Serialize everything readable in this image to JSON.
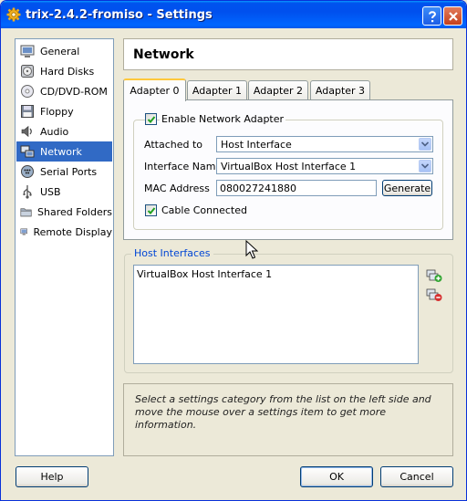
{
  "window": {
    "title": "trix-2.4.2-fromiso - Settings"
  },
  "sidebar": {
    "items": [
      {
        "label": "General",
        "icon": "general-icon",
        "selected": false
      },
      {
        "label": "Hard Disks",
        "icon": "hard-disk-icon",
        "selected": false
      },
      {
        "label": "CD/DVD-ROM",
        "icon": "cd-dvd-icon",
        "selected": false
      },
      {
        "label": "Floppy",
        "icon": "floppy-icon",
        "selected": false
      },
      {
        "label": "Audio",
        "icon": "audio-icon",
        "selected": false
      },
      {
        "label": "Network",
        "icon": "network-icon",
        "selected": true
      },
      {
        "label": "Serial Ports",
        "icon": "serial-port-icon",
        "selected": false
      },
      {
        "label": "USB",
        "icon": "usb-icon",
        "selected": false
      },
      {
        "label": "Shared Folders",
        "icon": "shared-folders-icon",
        "selected": false
      },
      {
        "label": "Remote Display",
        "icon": "remote-display-icon",
        "selected": false
      }
    ]
  },
  "header": {
    "title": "Network"
  },
  "tabs": [
    {
      "label": "Adapter 0",
      "active": true
    },
    {
      "label": "Adapter 1",
      "active": false
    },
    {
      "label": "Adapter 2",
      "active": false
    },
    {
      "label": "Adapter 3",
      "active": false
    }
  ],
  "adapter": {
    "enable_label": "Enable Network Adapter",
    "enable_checked": true,
    "attached_to_label": "Attached to",
    "attached_to_value": "Host Interface",
    "interface_name_label": "Interface Name",
    "interface_name_value": "VirtualBox Host Interface 1",
    "mac_label": "MAC Address",
    "mac_value": "080027241880",
    "generate_label": "Generate",
    "cable_label": "Cable Connected",
    "cable_checked": true
  },
  "host_interfaces": {
    "title": "Host Interfaces",
    "items": [
      "VirtualBox Host Interface 1"
    ]
  },
  "info": {
    "text": "Select a settings category from the list on the left side and move the mouse over a settings item to get more information."
  },
  "footer": {
    "help_label": "Help",
    "ok_label": "OK",
    "cancel_label": "Cancel"
  },
  "colors": {
    "title_bar": "#0054e3",
    "selection": "#316ac5",
    "group_title": "#0046d5",
    "window_bg": "#ece9d8"
  }
}
